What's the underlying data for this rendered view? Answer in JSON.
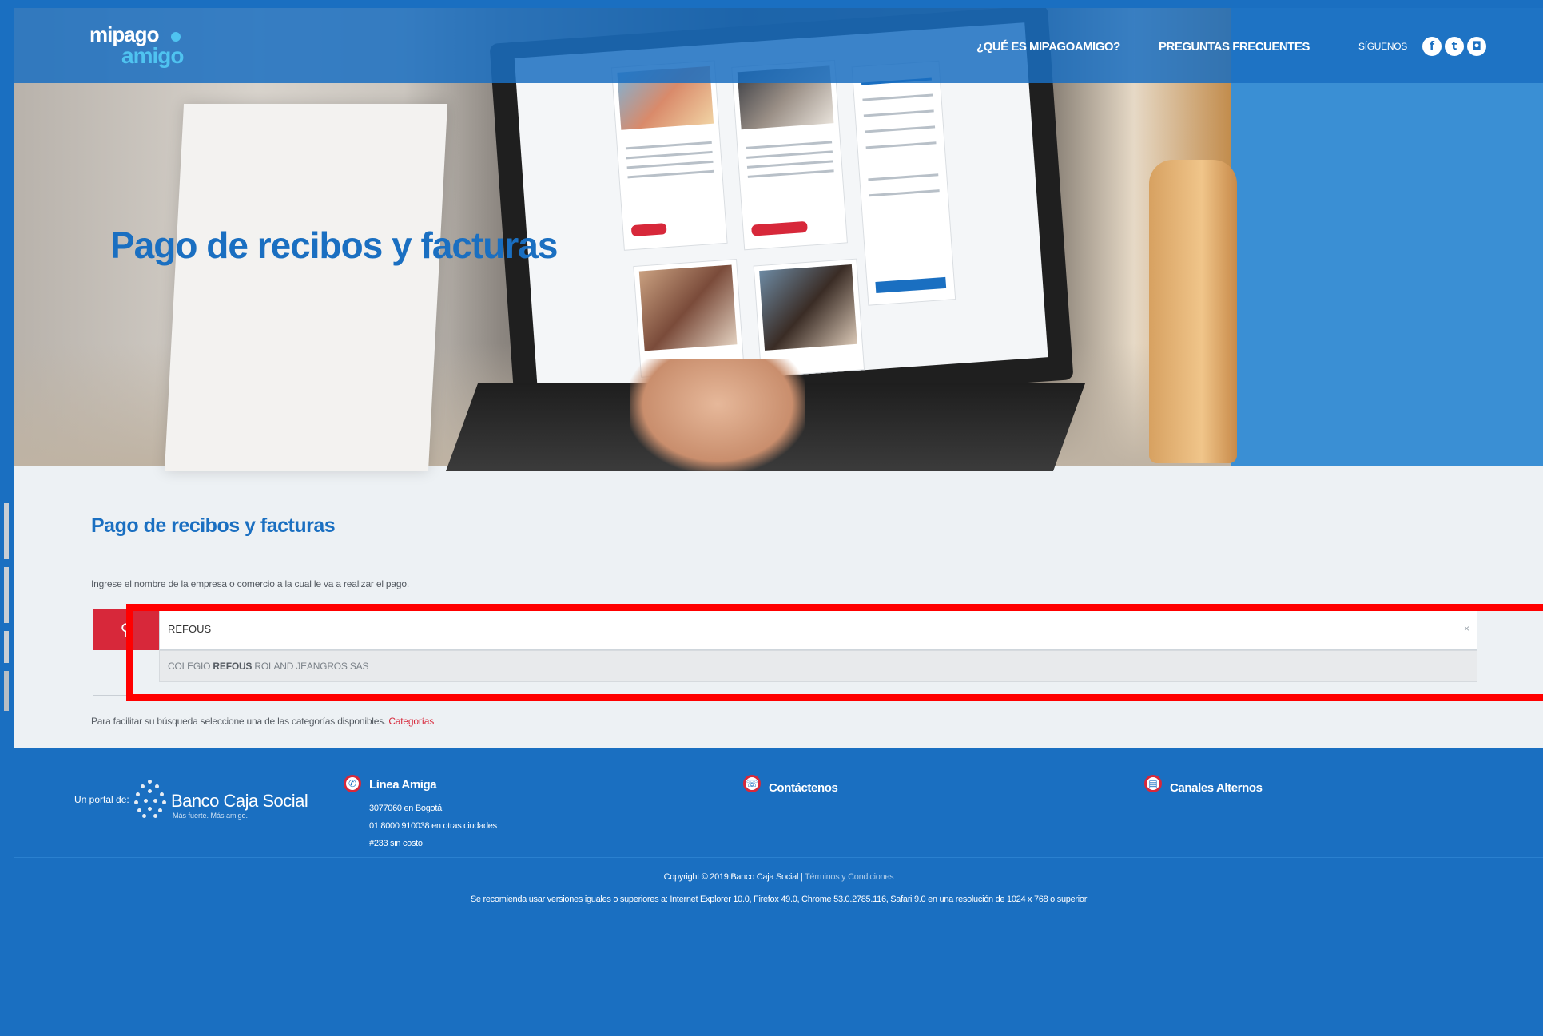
{
  "header": {
    "logo_line1": "mipago",
    "logo_line2": "amigo",
    "nav": [
      "¿QUÉ ES MIPAGOAMIGO?",
      "PREGUNTAS FRECUENTES"
    ],
    "follow_label": "SÍGUENOS",
    "social_icons": [
      "facebook-icon",
      "twitter-icon",
      "instagram-icon"
    ]
  },
  "hero": {
    "title": "Pago de recibos y facturas"
  },
  "main": {
    "title": "Pago de recibos y facturas",
    "instructions": "Ingrese el nombre de la empresa o comercio a la cual le va a realizar el pago.",
    "search_value": "REFOUS",
    "clear_label": "×",
    "suggestion_prefix": "COLEGIO ",
    "suggestion_match": "REFOUS",
    "suggestion_suffix": " ROLAND JEANGROS SAS",
    "help_text": "Para facilitar su búsqueda seleccione una de las categorías disponibles.",
    "help_link": "Categorías"
  },
  "footer": {
    "portal_label": "Un portal de:",
    "bank_name": "Banco Caja Social",
    "bank_tagline": "Más fuerte. Más amigo.",
    "linea_title": "Línea Amiga",
    "linea_lines": [
      "3077060 en Bogotá",
      "01 8000 910038 en otras ciudades",
      "#233 sin costo"
    ],
    "contact_title": "Contáctenos",
    "channels_title": "Canales Alternos",
    "copyright": "Copyright © 2019 Banco Caja Social | ",
    "terms_link": "Términos y Condiciones",
    "recommendation": "Se recomienda usar versiones iguales o superiores a: Internet Explorer 10.0, Firefox 49.0, Chrome 53.0.2785.116, Safari 9.0 en una resolución de 1024 x 768 o superior"
  }
}
